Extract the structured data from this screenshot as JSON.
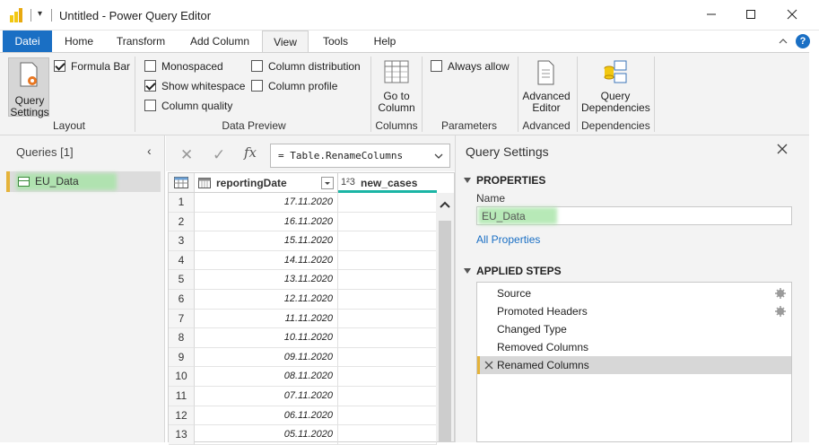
{
  "window": {
    "title": "Untitled - Power Query Editor",
    "qat_glyph": "▾"
  },
  "tabs": [
    "Datei",
    "Home",
    "Transform",
    "Add Column",
    "View",
    "Tools",
    "Help"
  ],
  "ribbon": {
    "layout": {
      "query_settings_label": "Query Settings",
      "formula_bar_label": "Formula Bar",
      "formula_bar_checked": true,
      "group_label": "Layout"
    },
    "data_preview": {
      "monospaced": "Monospaced",
      "show_whitespace": "Show whitespace",
      "column_quality": "Column quality",
      "column_distribution": "Column distribution",
      "column_profile": "Column profile",
      "group_label": "Data Preview"
    },
    "columns": {
      "go_to_column": "Go to Column",
      "group_label": "Columns"
    },
    "parameters": {
      "always_allow": "Always allow",
      "group_label": "Parameters"
    },
    "advanced": {
      "advanced_editor": "Advanced Editor",
      "group_label": "Advanced"
    },
    "dependencies": {
      "query_dependencies": "Query Dependencies",
      "group_label": "Dependencies"
    }
  },
  "queries": {
    "header": "Queries [1]",
    "items": [
      {
        "label": "EU_Data"
      }
    ]
  },
  "formula": {
    "text": "= Table.RenameColumns",
    "cancel_glyph": "✕",
    "commit_glyph": "✓",
    "fx_glyph": "fx"
  },
  "grid": {
    "columns": [
      {
        "name": "reportingDate",
        "type_glyph": "📅"
      },
      {
        "name": "new_cases",
        "type_glyph": "1²3"
      }
    ],
    "rows": [
      {
        "n": "1",
        "date": "17.11.2020"
      },
      {
        "n": "2",
        "date": "16.11.2020"
      },
      {
        "n": "3",
        "date": "15.11.2020"
      },
      {
        "n": "4",
        "date": "14.11.2020"
      },
      {
        "n": "5",
        "date": "13.11.2020"
      },
      {
        "n": "6",
        "date": "12.11.2020"
      },
      {
        "n": "7",
        "date": "11.11.2020"
      },
      {
        "n": "8",
        "date": "10.11.2020"
      },
      {
        "n": "9",
        "date": "09.11.2020"
      },
      {
        "n": "10",
        "date": "08.11.2020"
      },
      {
        "n": "11",
        "date": "07.11.2020"
      },
      {
        "n": "12",
        "date": "06.11.2020"
      },
      {
        "n": "13",
        "date": "05.11.2020"
      }
    ]
  },
  "settings": {
    "title": "Query Settings",
    "properties_header": "PROPERTIES",
    "name_label": "Name",
    "name_value": "EU_Data",
    "all_properties": "All Properties",
    "applied_steps_header": "APPLIED STEPS",
    "steps": [
      {
        "label": "Source",
        "has_gear": true
      },
      {
        "label": "Promoted Headers",
        "has_gear": true
      },
      {
        "label": "Changed Type",
        "has_gear": false
      },
      {
        "label": "Removed Columns",
        "has_gear": false
      },
      {
        "label": "Renamed Columns",
        "has_gear": false,
        "selected": true
      }
    ]
  },
  "colors": {
    "accent": "#1a6fc4",
    "selection_bar": "#e5b33a",
    "highlight_green": "#a6e4a6",
    "grid_header_underline": "#1bb5a5"
  }
}
